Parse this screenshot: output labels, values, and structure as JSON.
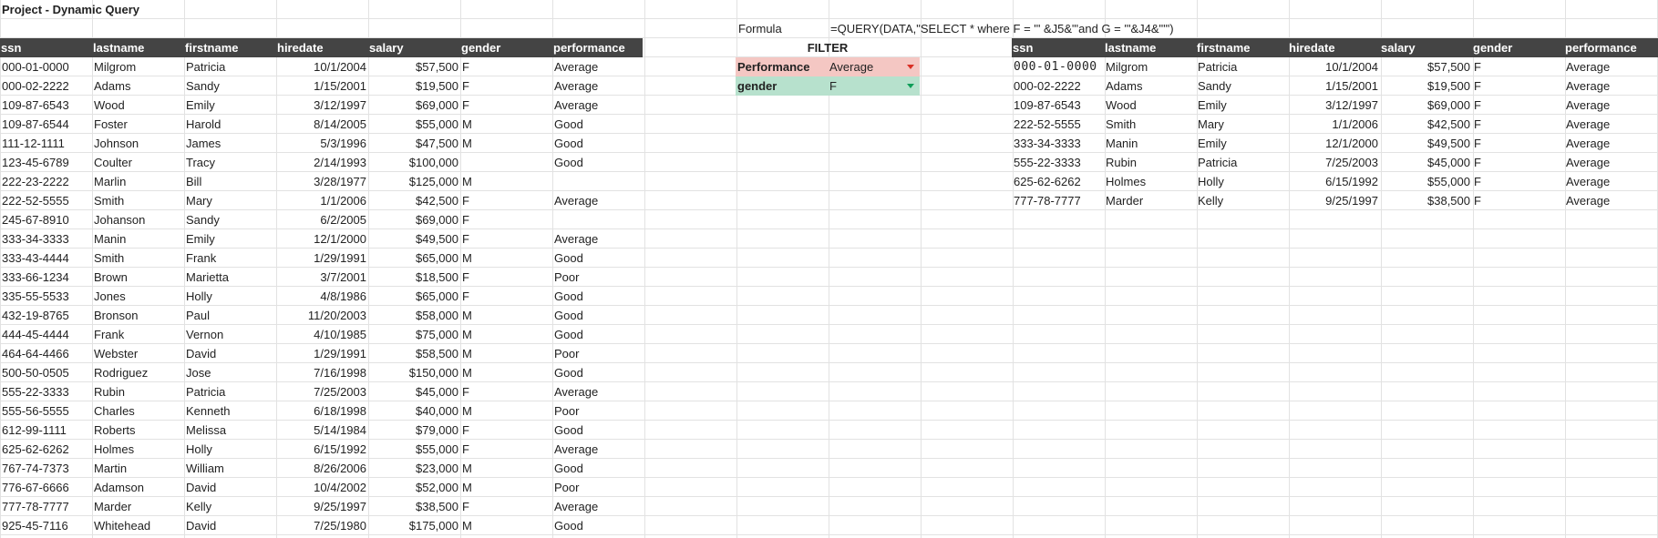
{
  "sheet": {
    "title": "Project - Dynamic Query",
    "formula_label": "Formula",
    "formula_text": "=QUERY(DATA,\"SELECT * where F = '\" &J5&\"'and G = '\"&J4&\"'\")"
  },
  "left_table": {
    "columns": [
      "ssn",
      "lastname",
      "firstname",
      "hiredate",
      "salary",
      "gender",
      "performance"
    ],
    "rows": [
      [
        "000-01-0000",
        "Milgrom",
        "Patricia",
        "10/1/2004",
        "$57,500",
        "F",
        "Average"
      ],
      [
        "000-02-2222",
        "Adams",
        "Sandy",
        "1/15/2001",
        "$19,500",
        "F",
        "Average"
      ],
      [
        "109-87-6543",
        "Wood",
        "Emily",
        "3/12/1997",
        "$69,000",
        "F",
        "Average"
      ],
      [
        "109-87-6544",
        "Foster",
        "Harold",
        "8/14/2005",
        "$55,000",
        "M",
        "Good"
      ],
      [
        "111-12-1111",
        "Johnson",
        "James",
        "5/3/1996",
        "$47,500",
        "M",
        "Good"
      ],
      [
        "123-45-6789",
        "Coulter",
        "Tracy",
        "2/14/1993",
        "$100,000",
        "",
        "Good"
      ],
      [
        "222-23-2222",
        "Marlin",
        "Bill",
        "3/28/1977",
        "$125,000",
        "M",
        ""
      ],
      [
        "222-52-5555",
        "Smith",
        "Mary",
        "1/1/2006",
        "$42,500",
        "F",
        "Average"
      ],
      [
        "245-67-8910",
        "Johanson",
        "Sandy",
        "6/2/2005",
        "$69,000",
        "F",
        ""
      ],
      [
        "333-34-3333",
        "Manin",
        "Emily",
        "12/1/2000",
        "$49,500",
        "F",
        "Average"
      ],
      [
        "333-43-4444",
        "Smith",
        "Frank",
        "1/29/1991",
        "$65,000",
        "M",
        "Good"
      ],
      [
        "333-66-1234",
        "Brown",
        "Marietta",
        "3/7/2001",
        "$18,500",
        "F",
        "Poor"
      ],
      [
        "335-55-5533",
        "Jones",
        "Holly",
        "4/8/1986",
        "$65,000",
        "F",
        "Good"
      ],
      [
        "432-19-8765",
        "Bronson",
        "Paul",
        "11/20/2003",
        "$58,000",
        "M",
        "Good"
      ],
      [
        "444-45-4444",
        "Frank",
        "Vernon",
        "4/10/1985",
        "$75,000",
        "M",
        "Good"
      ],
      [
        "464-64-4466",
        "Webster",
        "David",
        "1/29/1991",
        "$58,500",
        "M",
        "Poor"
      ],
      [
        "500-50-0505",
        "Rodriguez",
        "Jose",
        "7/16/1998",
        "$150,000",
        "M",
        "Good"
      ],
      [
        "555-22-3333",
        "Rubin",
        "Patricia",
        "7/25/2003",
        "$45,000",
        "F",
        "Average"
      ],
      [
        "555-56-5555",
        "Charles",
        "Kenneth",
        "6/18/1998",
        "$40,000",
        "M",
        "Poor"
      ],
      [
        "612-99-1111",
        "Roberts",
        "Melissa",
        "5/14/1984",
        "$79,000",
        "F",
        "Good"
      ],
      [
        "625-62-6262",
        "Holmes",
        "Holly",
        "6/15/1992",
        "$55,000",
        "F",
        "Average"
      ],
      [
        "767-74-7373",
        "Martin",
        "William",
        "8/26/2006",
        "$23,000",
        "M",
        "Good"
      ],
      [
        "776-67-6666",
        "Adamson",
        "David",
        "10/4/2002",
        "$52,000",
        "M",
        "Poor"
      ],
      [
        "777-78-7777",
        "Marder",
        "Kelly",
        "9/25/1997",
        "$38,500",
        "F",
        "Average"
      ],
      [
        "925-45-7116",
        "Whitehead",
        "David",
        "7/25/1980",
        "$175,000",
        "M",
        "Good"
      ]
    ]
  },
  "filter": {
    "title": "FILTER",
    "performance_label": "Performance",
    "performance_value": "Average",
    "gender_label": "gender",
    "gender_value": "F"
  },
  "right_table": {
    "columns": [
      "ssn",
      "lastname",
      "firstname",
      "hiredate",
      "salary",
      "gender",
      "performance"
    ],
    "rows": [
      [
        "000-01-0000",
        "Milgrom",
        "Patricia",
        "10/1/2004",
        "$57,500",
        "F",
        "Average"
      ],
      [
        "000-02-2222",
        "Adams",
        "Sandy",
        "1/15/2001",
        "$19,500",
        "F",
        "Average"
      ],
      [
        "109-87-6543",
        "Wood",
        "Emily",
        "3/12/1997",
        "$69,000",
        "F",
        "Average"
      ],
      [
        "222-52-5555",
        "Smith",
        "Mary",
        "1/1/2006",
        "$42,500",
        "F",
        "Average"
      ],
      [
        "333-34-3333",
        "Manin",
        "Emily",
        "12/1/2000",
        "$49,500",
        "F",
        "Average"
      ],
      [
        "555-22-3333",
        "Rubin",
        "Patricia",
        "7/25/2003",
        "$45,000",
        "F",
        "Average"
      ],
      [
        "625-62-6262",
        "Holmes",
        "Holly",
        "6/15/1992",
        "$55,000",
        "F",
        "Average"
      ],
      [
        "777-78-7777",
        "Marder",
        "Kelly",
        "9/25/1997",
        "$38,500",
        "F",
        "Average"
      ]
    ]
  },
  "colors": {
    "header_bg": "#444444",
    "performance_fill": "#f4c7c3",
    "gender_fill": "#b7e1cd"
  }
}
